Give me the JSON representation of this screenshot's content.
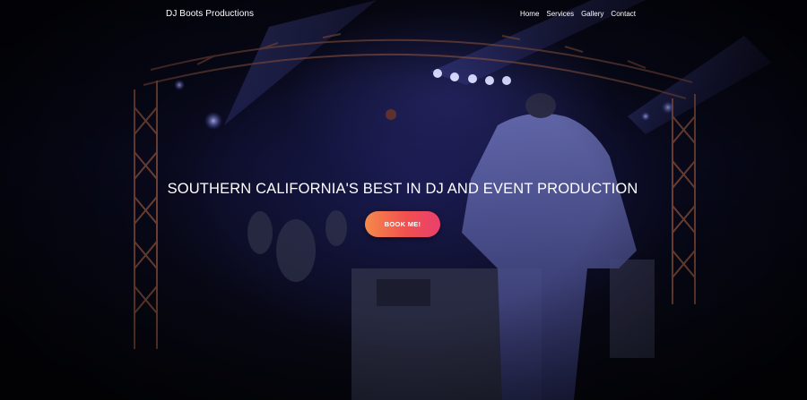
{
  "navbar": {
    "brand": "DJ Boots Productions",
    "links": [
      {
        "label": "Home"
      },
      {
        "label": "Services"
      },
      {
        "label": "Gallery"
      },
      {
        "label": "Contact"
      }
    ]
  },
  "hero": {
    "headline": "SOUTHERN CALIFORNIA'S BEST IN DJ AND EVENT PRODUCTION",
    "cta_label": "BOOK ME!"
  },
  "colors": {
    "cta_gradient_start": "#f58a4b",
    "cta_gradient_end": "#ea3f6d",
    "background": "#05060d",
    "stage_light": "#6a6fff"
  }
}
